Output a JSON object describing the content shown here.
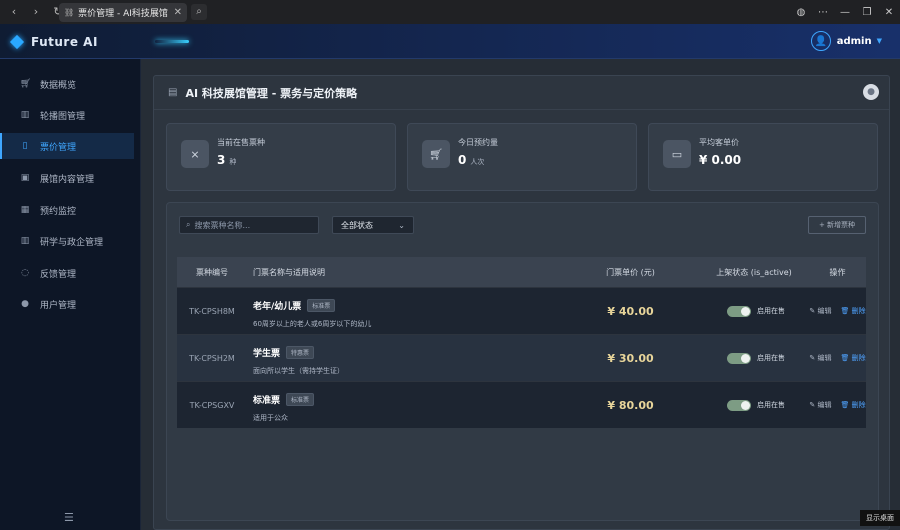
{
  "browser": {
    "tab_title": "票价管理 - AI科技展馆",
    "back_icon": "chevron-left-icon",
    "controls": [
      "globe-icon",
      "more-icon",
      "minimize-icon",
      "restore-icon",
      "close-icon"
    ]
  },
  "header": {
    "brand": "Future AI",
    "user": "admin"
  },
  "sidebar": {
    "items": [
      {
        "label": "数据概览",
        "icon": "cart-icon",
        "active": false
      },
      {
        "label": "轮播图管理",
        "icon": "building-icon",
        "active": false
      },
      {
        "label": "票价管理",
        "icon": "ticket-icon",
        "active": true
      },
      {
        "label": "展馆内容管理",
        "icon": "image-icon",
        "active": false
      },
      {
        "label": "预约监控",
        "icon": "calendar-icon",
        "active": false
      },
      {
        "label": "研学与政企管理",
        "icon": "building-icon",
        "active": false
      },
      {
        "label": "反馈管理",
        "icon": "chat-icon",
        "active": false
      },
      {
        "label": "用户管理",
        "icon": "user-icon",
        "active": false
      }
    ]
  },
  "page": {
    "title": "AI 科技展馆管理 - 票务与定价策略"
  },
  "stats": [
    {
      "label": "当前在售票种",
      "value": "3",
      "unit": "种",
      "icon": "ticket-icon"
    },
    {
      "label": "今日预约量",
      "value": "0",
      "unit": "人次",
      "icon": "cart-icon"
    },
    {
      "label": "平均客单价",
      "value": "¥ 0.00",
      "unit": "",
      "icon": "folder-icon"
    }
  ],
  "toolbar": {
    "search_placeholder": "搜索票种名称...",
    "status_filter": "全部状态",
    "add_label": "+ 新增票种"
  },
  "table": {
    "headers": [
      "票种编号",
      "门票名称与适用说明",
      "门票单价 (元)",
      "上架状态 (is_active)",
      "操作"
    ],
    "rows": [
      {
        "code": "TK-CPSH8M",
        "name": "老年/幼儿票",
        "tag": "标准票",
        "desc": "60周岁以上的老人或6周岁以下的幼儿",
        "price": "¥ 40.00",
        "status": "启用在售",
        "edit": "编辑",
        "delete": "删除"
      },
      {
        "code": "TK-CPSH2M",
        "name": "学生票",
        "tag": "特惠票",
        "desc": "面向所以学生（需持学生证）",
        "price": "¥ 30.00",
        "status": "启用在售",
        "edit": "编辑",
        "delete": "删除"
      },
      {
        "code": "TK-CPSGXV",
        "name": "标准票",
        "tag": "标准票",
        "desc": "适用于公众",
        "price": "¥ 80.00",
        "status": "启用在售",
        "edit": "编辑",
        "delete": "删除"
      }
    ]
  },
  "taskbar": {
    "show_desktop": "显示桌面"
  }
}
